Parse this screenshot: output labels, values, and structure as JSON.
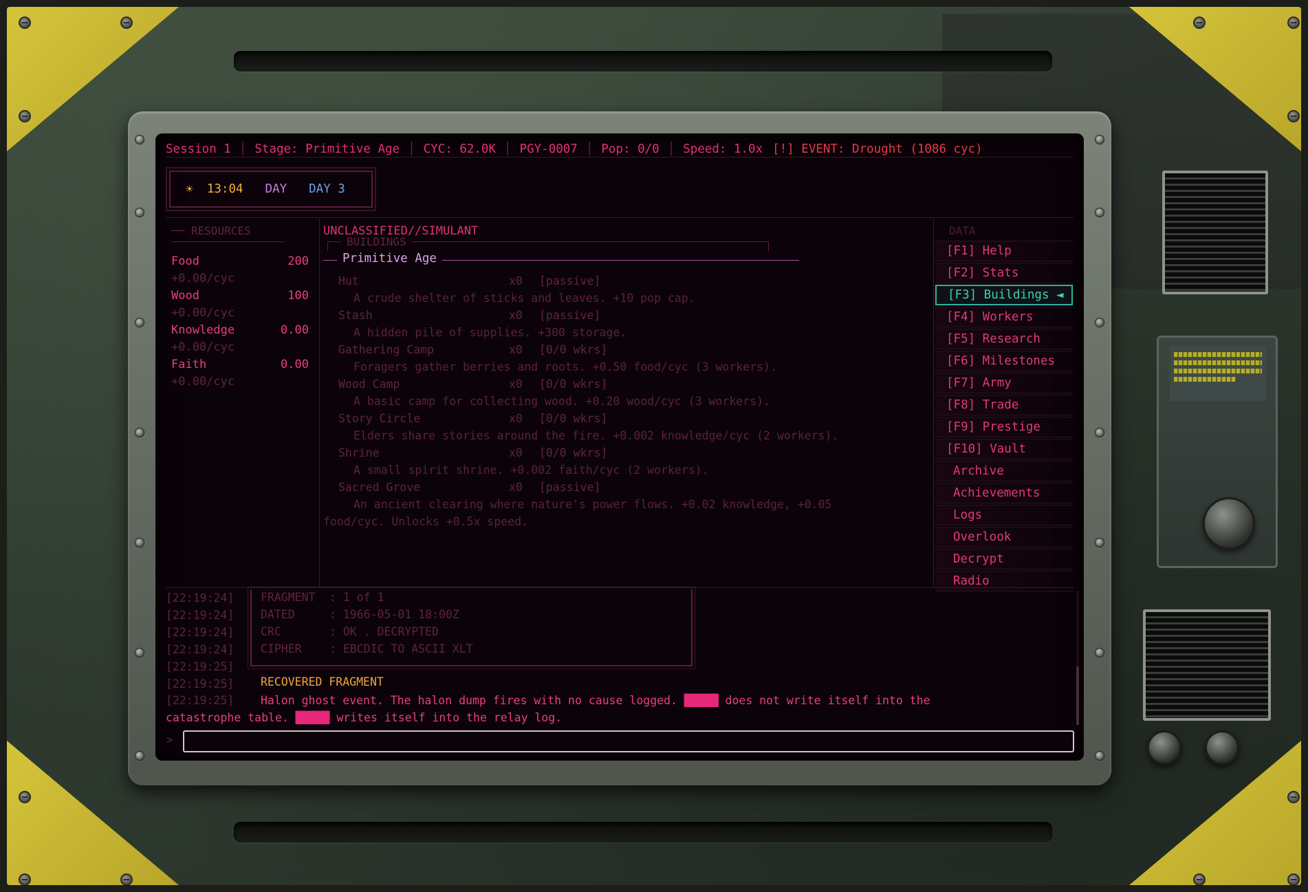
{
  "status_bar": {
    "session": "Session 1",
    "stage": "Stage: Primitive Age",
    "cyc": "CYC: 62.0K",
    "id": "PGY-0007",
    "pop": "Pop: 0/0",
    "speed": "Speed: 1.0x",
    "event": "[!] EVENT: Drought (1086 cyc)"
  },
  "clock": {
    "icon": "sun-icon",
    "time": "13:04",
    "phase": "DAY",
    "day": "DAY 3"
  },
  "resources": {
    "title": "RESOURCES",
    "items": [
      {
        "name": "Food",
        "value": "200",
        "rate": "+0.00/cyc"
      },
      {
        "name": "Wood",
        "value": "100",
        "rate": "+0.00/cyc"
      },
      {
        "name": "Knowledge",
        "value": "0.00",
        "rate": "+0.00/cyc"
      },
      {
        "name": "Faith",
        "value": "0.00",
        "rate": "+0.00/cyc"
      }
    ]
  },
  "main": {
    "classification": "UNCLASSIFIED//SIMULANT",
    "section_title": "BUILDINGS",
    "age_title": "Primitive Age",
    "buildings": [
      {
        "name": "Hut",
        "count": "x0",
        "mode": "[passive]",
        "desc": "A crude shelter of sticks and leaves. +10 pop cap."
      },
      {
        "name": "Stash",
        "count": "x0",
        "mode": "[passive]",
        "desc": "A hidden pile of supplies. +300 storage."
      },
      {
        "name": "Gathering Camp",
        "count": "x0",
        "mode": "[0/0 wkrs]",
        "desc": "Foragers gather berries and roots. +0.50 food/cyc (3 workers)."
      },
      {
        "name": "Wood Camp",
        "count": "x0",
        "mode": "[0/0 wkrs]",
        "desc": "A basic camp for collecting wood. +0.20 wood/cyc (3 workers)."
      },
      {
        "name": "Story Circle",
        "count": "x0",
        "mode": "[0/0 wkrs]",
        "desc": "Elders share stories around the fire. +0.002 knowledge/cyc (2 workers)."
      },
      {
        "name": "Shrine",
        "count": "x0",
        "mode": "[0/0 wkrs]",
        "desc": "A small spirit shrine. +0.002 faith/cyc (2 workers)."
      },
      {
        "name": "Sacred Grove",
        "count": "x0",
        "mode": "[passive]",
        "desc_line1": "An ancient clearing where nature's power flows. +0.02 knowledge, +0.05",
        "desc_line2": "food/cyc. Unlocks +0.5x speed."
      }
    ]
  },
  "nav": {
    "title": "DATA",
    "items": [
      {
        "label": "[F1] Help"
      },
      {
        "label": "[F2] Stats"
      },
      {
        "label": "[F3] Buildings ◄"
      },
      {
        "label": "[F4] Workers"
      },
      {
        "label": "[F5] Research"
      },
      {
        "label": "[F6] Milestones"
      },
      {
        "label": "[F7] Army"
      },
      {
        "label": "[F8] Trade"
      },
      {
        "label": "[F9] Prestige"
      },
      {
        "label": "[F10] Vault"
      },
      {
        "label": "Archive"
      },
      {
        "label": "Achievements"
      },
      {
        "label": "Logs"
      },
      {
        "label": "Overlook"
      },
      {
        "label": "Decrypt"
      },
      {
        "label": "Radio"
      }
    ],
    "active_index": 2
  },
  "log": {
    "timestamps": [
      "[22:19:24]",
      "[22:19:24]",
      "[22:19:24]",
      "[22:19:24]",
      "[22:19:25]",
      "[22:19:25]",
      "[22:19:25]"
    ],
    "fragment": [
      {
        "key": "FRAGMENT",
        "value": ": 1 of 1"
      },
      {
        "key": "DATED",
        "value": ": 1966-05-01 18:00Z"
      },
      {
        "key": "CRC",
        "value": ": OK . DECRYPTED"
      },
      {
        "key": "CIPHER",
        "value": ": EBCDIC TO ASCII XLT"
      }
    ],
    "title": "RECOVERED FRAGMENT",
    "body_part1": "Halon ghost event. The halon dump fires with no cause logged.",
    "redacted1": "█████",
    "body_part2": "does not write itself into the catastrophe table.",
    "redacted2": "█████",
    "body_part3": "writes itself into the relay log."
  },
  "command": {
    "prompt": ">",
    "value": "",
    "placeholder": ""
  },
  "colors": {
    "accent": "#e23a74",
    "active_nav": "#3fd0b8",
    "clock_time": "#f2b132",
    "event": "#e33a4a",
    "frame_yellow": "#d5c43a"
  }
}
